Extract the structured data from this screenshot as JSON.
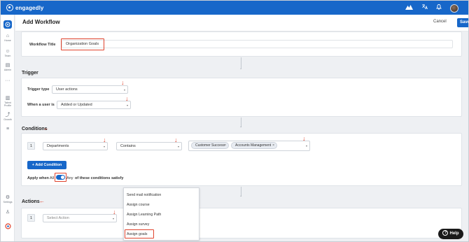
{
  "app": {
    "brand": "engagedly"
  },
  "topbar": {
    "icons": [
      "mountain-icon",
      "translate-icon",
      "bell-icon",
      "avatar"
    ]
  },
  "sidebar": {
    "items": [
      {
        "label": "",
        "icon": "home-active-icon"
      },
      {
        "label": "Home",
        "icon": "home-icon"
      },
      {
        "label": "Team",
        "icon": "team-icon"
      },
      {
        "label": "Admin",
        "icon": "admin-icon"
      },
      {
        "label": "",
        "icon": "more-icon"
      },
      {
        "label": "Talent Profile",
        "icon": "talent-profile-icon"
      },
      {
        "label": "Growth",
        "icon": "growth-icon"
      },
      {
        "label": "",
        "icon": "menu-icon"
      },
      {
        "label": "Settings",
        "icon": "settings-icon"
      },
      {
        "label": "",
        "icon": "user-icon"
      }
    ]
  },
  "header": {
    "title": "Add Workflow",
    "cancel_label": "Cancel",
    "save_label": "Save"
  },
  "workflow": {
    "title_label": "Workflow Title",
    "title_value": "Organization Goals"
  },
  "trigger": {
    "section_title": "Trigger",
    "type_label": "Trigger type",
    "type_value": "User actions",
    "when_label": "When a user is",
    "when_value": "Added or Updated"
  },
  "conditions": {
    "section_title": "Conditions",
    "row_number": "1",
    "field_value": "Departments",
    "operator_value": "Contains",
    "chips": [
      "Customer Success",
      "Accounts Management"
    ],
    "add_label": "+ Add Condition",
    "apply_prefix": "Apply when",
    "apply_all": "All",
    "apply_any": "Any",
    "apply_suffix": "of these conditions satisfy"
  },
  "actions": {
    "section_title": "Actions",
    "row_number": "1",
    "select_placeholder": "Select Action",
    "dropdown_items": [
      "Send mail notification",
      "Assign course",
      "Assign Learning Path",
      "Assign survey",
      "Assign goals"
    ]
  },
  "help": {
    "label": "Help"
  },
  "colors": {
    "brand": "#1767c9",
    "highlight": "#e0442e"
  }
}
